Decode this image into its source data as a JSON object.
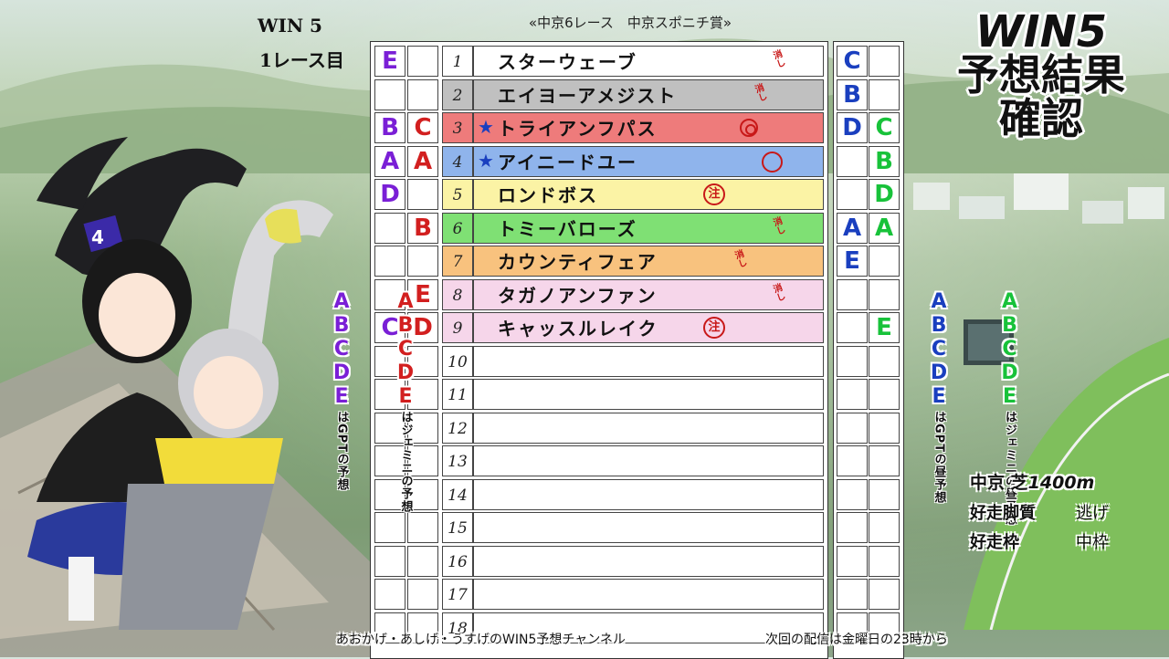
{
  "header": {
    "win5": "WIN 5",
    "race_day": "1レース目",
    "race_title": "«中京6レース　中京スポニチ賞»"
  },
  "title": {
    "line1": "WIN5",
    "line2": "予想結果",
    "line3": "確認"
  },
  "colors": {
    "purple": "#7a1fd6",
    "red": "#d21f1f",
    "blue": "#1a3fbf",
    "green": "#18c23a"
  },
  "horses": [
    {
      "num": "1",
      "name": "スターウェーブ",
      "bg": "#ffffff",
      "gpt": "E",
      "gemini": "",
      "star": false,
      "badge": "消し",
      "badge_type": "kesi"
    },
    {
      "num": "2",
      "name": "エイヨーアメジスト",
      "bg": "#c0c0c0",
      "gpt": "",
      "gemini": "",
      "star": false,
      "badge": "消し",
      "badge_type": "kesi"
    },
    {
      "num": "3",
      "name": "トライアンフパス",
      "bg": "#ee7b7b",
      "gpt": "B",
      "gemini": "C",
      "star": true,
      "badge": "◎",
      "badge_type": "double"
    },
    {
      "num": "4",
      "name": "アイニードユー",
      "bg": "#8fb4ec",
      "gpt": "A",
      "gemini": "A",
      "star": true,
      "badge": "○",
      "badge_type": "single"
    },
    {
      "num": "5",
      "name": "ロンドボス",
      "bg": "#fbf3a5",
      "gpt": "D",
      "gemini": "",
      "star": false,
      "badge": "注",
      "badge_type": "chu"
    },
    {
      "num": "6",
      "name": "トミーバローズ",
      "bg": "#7fe074",
      "gpt": "",
      "gemini": "B",
      "star": false,
      "badge": "消し",
      "badge_type": "kesi"
    },
    {
      "num": "7",
      "name": "カウンティフェア",
      "bg": "#f8c27e",
      "gpt": "",
      "gemini": "",
      "star": false,
      "badge": "消し",
      "badge_type": "kesi"
    },
    {
      "num": "8",
      "name": "タガノアンファン",
      "bg": "#f6d6ea",
      "gpt": "",
      "gemini": "E",
      "star": false,
      "badge": "消し",
      "badge_type": "kesi"
    },
    {
      "num": "9",
      "name": "キャッスルレイク",
      "bg": "#f6d6ea",
      "gpt": "C",
      "gemini": "D",
      "star": false,
      "badge": "注",
      "badge_type": "chu"
    },
    {
      "num": "10",
      "name": "",
      "bg": "#ffffff",
      "gpt": "",
      "gemini": "",
      "star": false,
      "badge": "",
      "badge_type": ""
    },
    {
      "num": "11",
      "name": "",
      "bg": "#ffffff",
      "gpt": "",
      "gemini": "",
      "star": false,
      "badge": "",
      "badge_type": ""
    },
    {
      "num": "12",
      "name": "",
      "bg": "#ffffff",
      "gpt": "",
      "gemini": "",
      "star": false,
      "badge": "",
      "badge_type": ""
    },
    {
      "num": "13",
      "name": "",
      "bg": "#ffffff",
      "gpt": "",
      "gemini": "",
      "star": false,
      "badge": "",
      "badge_type": ""
    },
    {
      "num": "14",
      "name": "",
      "bg": "#ffffff",
      "gpt": "",
      "gemini": "",
      "star": false,
      "badge": "",
      "badge_type": ""
    },
    {
      "num": "15",
      "name": "",
      "bg": "#ffffff",
      "gpt": "",
      "gemini": "",
      "star": false,
      "badge": "",
      "badge_type": ""
    },
    {
      "num": "16",
      "name": "",
      "bg": "#ffffff",
      "gpt": "",
      "gemini": "",
      "star": false,
      "badge": "",
      "badge_type": ""
    },
    {
      "num": "17",
      "name": "",
      "bg": "#ffffff",
      "gpt": "",
      "gemini": "",
      "star": false,
      "badge": "",
      "badge_type": ""
    },
    {
      "num": "18",
      "name": "",
      "bg": "#ffffff",
      "gpt": "",
      "gemini": "",
      "star": false,
      "badge": "",
      "badge_type": ""
    }
  ],
  "noon": [
    {
      "blue": "C",
      "green": ""
    },
    {
      "blue": "B",
      "green": ""
    },
    {
      "blue": "D",
      "green": "C"
    },
    {
      "blue": "",
      "green": "B"
    },
    {
      "blue": "",
      "green": "D"
    },
    {
      "blue": "A",
      "green": "A"
    },
    {
      "blue": "E",
      "green": ""
    },
    {
      "blue": "",
      "green": ""
    },
    {
      "blue": "",
      "green": "E"
    }
  ],
  "legend_left": {
    "gpt": {
      "letters": [
        "A",
        "B",
        "C",
        "D",
        "E"
      ],
      "note": "はGPTの予想"
    },
    "gemini": {
      "letters": [
        "A",
        "B",
        "C",
        "D",
        "E"
      ],
      "note": "はジェミニの予想"
    }
  },
  "legend_right": {
    "gpt": {
      "letters": [
        "A",
        "B",
        "C",
        "D",
        "E"
      ],
      "note": "はGPTの昼予想"
    },
    "gemini": {
      "letters": [
        "A",
        "B",
        "C",
        "D",
        "E"
      ],
      "note": "はジェミニの昼予想"
    }
  },
  "course": {
    "venue": "中京",
    "surface": "芝",
    "distance": "1400m",
    "style_label": "好走脚質",
    "style_value": "逃げ",
    "gate_label": "好走枠",
    "gate_value": "中枠"
  },
  "footer": {
    "channel": "あおかげ・あしげ・うすげのWIN5予想チャンネル",
    "next": "次回の配信は金曜日の23時から"
  }
}
